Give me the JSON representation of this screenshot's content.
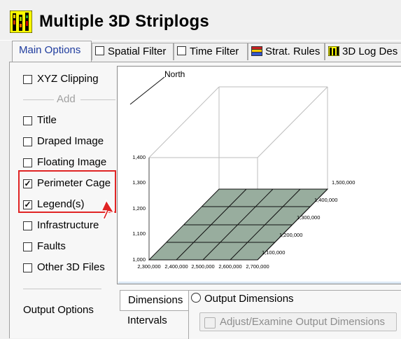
{
  "window": {
    "title": "Multiple 3D Striplogs",
    "icon": "striplog-app-icon"
  },
  "tabs": [
    {
      "label": "Main Options",
      "active": true
    },
    {
      "label": "Spatial Filter",
      "checkbox": true,
      "checked": false
    },
    {
      "label": "Time Filter",
      "checkbox": true,
      "checked": false
    },
    {
      "label": "Strat. Rules",
      "icon": "strat-rules-icon"
    },
    {
      "label": "3D Log Des",
      "icon": "log-design-icon"
    }
  ],
  "left": {
    "xyz_clipping": {
      "label": "XYZ Clipping",
      "checked": false
    },
    "add_separator": "Add",
    "items": [
      {
        "label": "Title",
        "checked": false
      },
      {
        "label": "Draped Image",
        "checked": false
      },
      {
        "label": "Floating Image",
        "checked": false
      },
      {
        "label": "Perimeter Cage",
        "checked": true
      },
      {
        "label": "Legend(s)",
        "checked": true
      },
      {
        "label": "Infrastructure",
        "checked": false
      },
      {
        "label": "Faults",
        "checked": false
      },
      {
        "label": "Other 3D Files",
        "checked": false
      }
    ],
    "output_options": "Output Options"
  },
  "preview": {
    "north_label": "North",
    "z_ticks": [
      "1,400",
      "1,300",
      "1,200",
      "1,100",
      "1,000"
    ],
    "x_ticks": [
      "2,300,000",
      "2,400,000",
      "2,500,000",
      "2,600,000",
      "2,700,000"
    ],
    "y_ticks": [
      "1,100,000",
      "1,200,000",
      "1,300,000",
      "1,400,000",
      "1,500,000"
    ],
    "plane_color": "#98ad9e"
  },
  "bottom": {
    "tabs": [
      "Dimensions",
      "Intervals"
    ],
    "radio_label": "Output Dimensions",
    "adjust_button": "Adjust/Examine Output Dimensions"
  },
  "colors": {
    "highlight": "#e02424",
    "active_tab_text": "#1f3c9e"
  }
}
